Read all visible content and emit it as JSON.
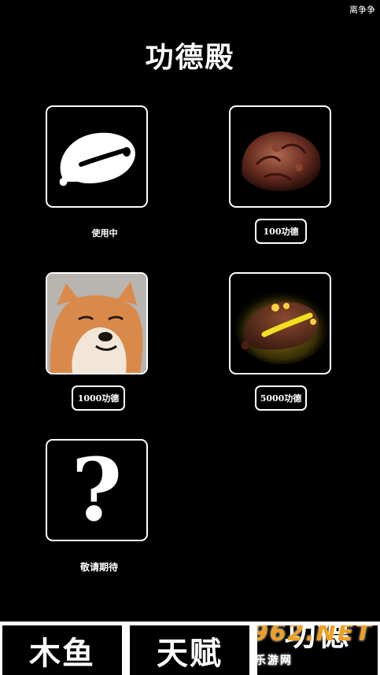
{
  "header": {
    "top_right_text": "离争争",
    "title": "功德殿"
  },
  "items": [
    {
      "name": "wooden-fish",
      "status": "使用中"
    },
    {
      "name": "rosewood-carving",
      "price_label": "100功德"
    },
    {
      "name": "shiba-dog",
      "price_label": "1000功德"
    },
    {
      "name": "glowing-wooden-fish",
      "price_label": "5000功德"
    },
    {
      "name": "mystery-item",
      "glyph": "?",
      "status": "敬请期待"
    }
  ],
  "tabs": [
    {
      "label": "木鱼"
    },
    {
      "label": "天赋"
    },
    {
      "label": "功德"
    }
  ],
  "watermark": {
    "text": "962.NET",
    "sub": "乐游网"
  },
  "colors": {
    "background": "#000000",
    "foreground": "#ffffff",
    "watermark": "#f0a020"
  }
}
